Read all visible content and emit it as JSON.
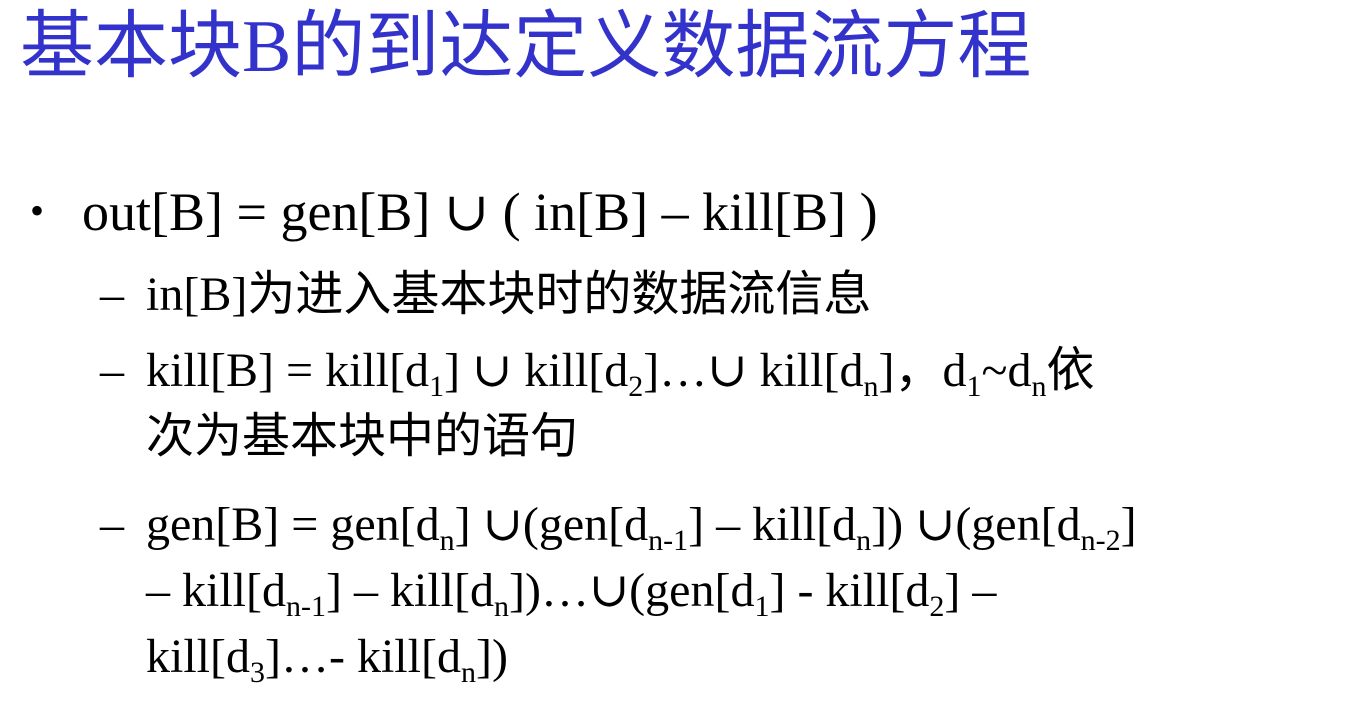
{
  "slide": {
    "title": "基本块B的到达定义数据流方程",
    "bullet_marker": "•",
    "dash_marker": "–",
    "equation": {
      "lhs": "out[B] = gen[B]",
      "union": "∪",
      "rhs": "( in[B] – kill[B] )"
    },
    "sub1": {
      "text": "in[B]为进入基本块时的数据流信息"
    },
    "sub2": {
      "p1": "kill[B] = kill[d",
      "sub_1": "1",
      "p2": "] ∪ kill[d",
      "sub_2": "2",
      "p3": "]…∪ kill[d",
      "sub_3": "n",
      "p4": "]，d",
      "sub_4": "1",
      "p5": "~d",
      "sub_5": "n",
      "p6": "依",
      "line2": "次为基本块中的语句"
    },
    "sub3": {
      "l1_p1": "gen[B] = gen[d",
      "l1_s1": "n",
      "l1_p2": "] ∪(gen[d",
      "l1_s2": "n-1",
      "l1_p3": "] – kill[d",
      "l1_s3": "n",
      "l1_p4": "]) ∪(gen[d",
      "l1_s4": "n-2",
      "l1_p5": "]",
      "l2_p1": "– kill[d",
      "l2_s1": "n-1",
      "l2_p2": "] – kill[d",
      "l2_s2": "n",
      "l2_p3": "])…∪(gen[d",
      "l2_s3": "1",
      "l2_p4": "] - kill[d",
      "l2_s4": "2",
      "l2_p5": "] –",
      "l3_p1": "kill[d",
      "l3_s1": "3",
      "l3_p2": "]…- kill[d",
      "l3_s2": "n",
      "l3_p3": "])"
    },
    "colors": {
      "title": "#3333cc",
      "text": "#000000",
      "background": "#ffffff"
    }
  }
}
